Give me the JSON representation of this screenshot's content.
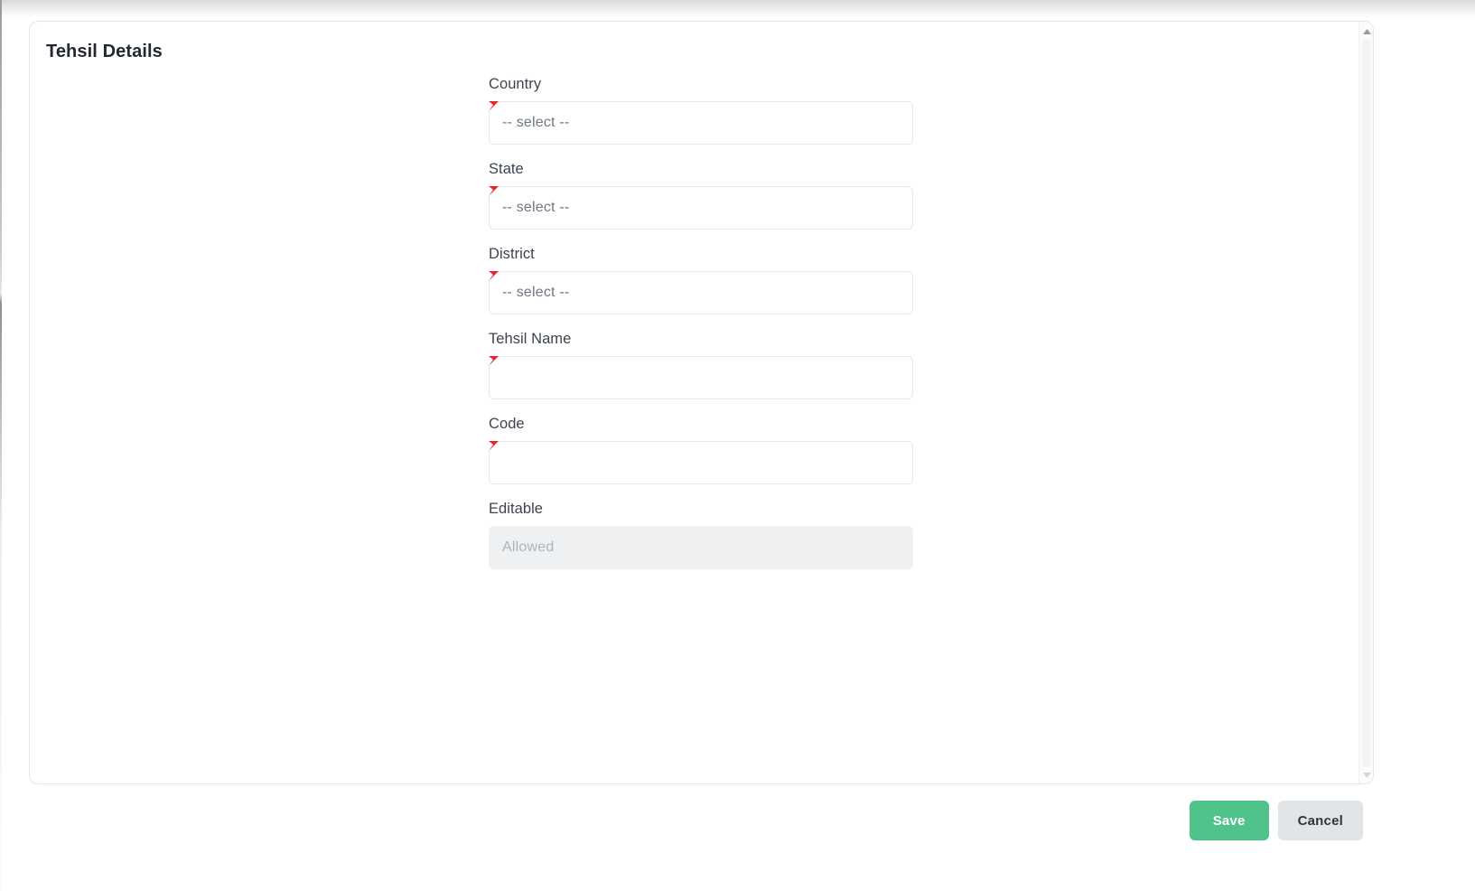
{
  "card": {
    "title": "Tehsil Details"
  },
  "form": {
    "fields": [
      {
        "label": "Country",
        "type": "select",
        "value": "-- select --",
        "required": true,
        "disabled": false,
        "name": "country"
      },
      {
        "label": "State",
        "type": "select",
        "value": "-- select --",
        "required": true,
        "disabled": false,
        "name": "state"
      },
      {
        "label": "District",
        "type": "select",
        "value": "-- select --",
        "required": true,
        "disabled": false,
        "name": "district"
      },
      {
        "label": "Tehsil Name",
        "type": "text",
        "value": "",
        "required": true,
        "disabled": false,
        "name": "tehsil-name"
      },
      {
        "label": "Code",
        "type": "text",
        "value": "",
        "required": true,
        "disabled": false,
        "name": "code"
      },
      {
        "label": "Editable",
        "type": "text",
        "value": "Allowed",
        "required": false,
        "disabled": true,
        "name": "editable"
      }
    ]
  },
  "footer": {
    "save_label": "Save",
    "cancel_label": "Cancel"
  },
  "scrollbar": {
    "up_icon": "triangle-up-icon",
    "down_icon": "triangle-down-icon"
  },
  "colors": {
    "required_marker": "#e8232a",
    "save_button": "#4fc38a",
    "cancel_button": "#e2e5e8",
    "card_border": "#e3e5e8",
    "label_text": "#3d4450",
    "placeholder_text": "#6f7782",
    "disabled_field_bg": "#eef0f2"
  }
}
